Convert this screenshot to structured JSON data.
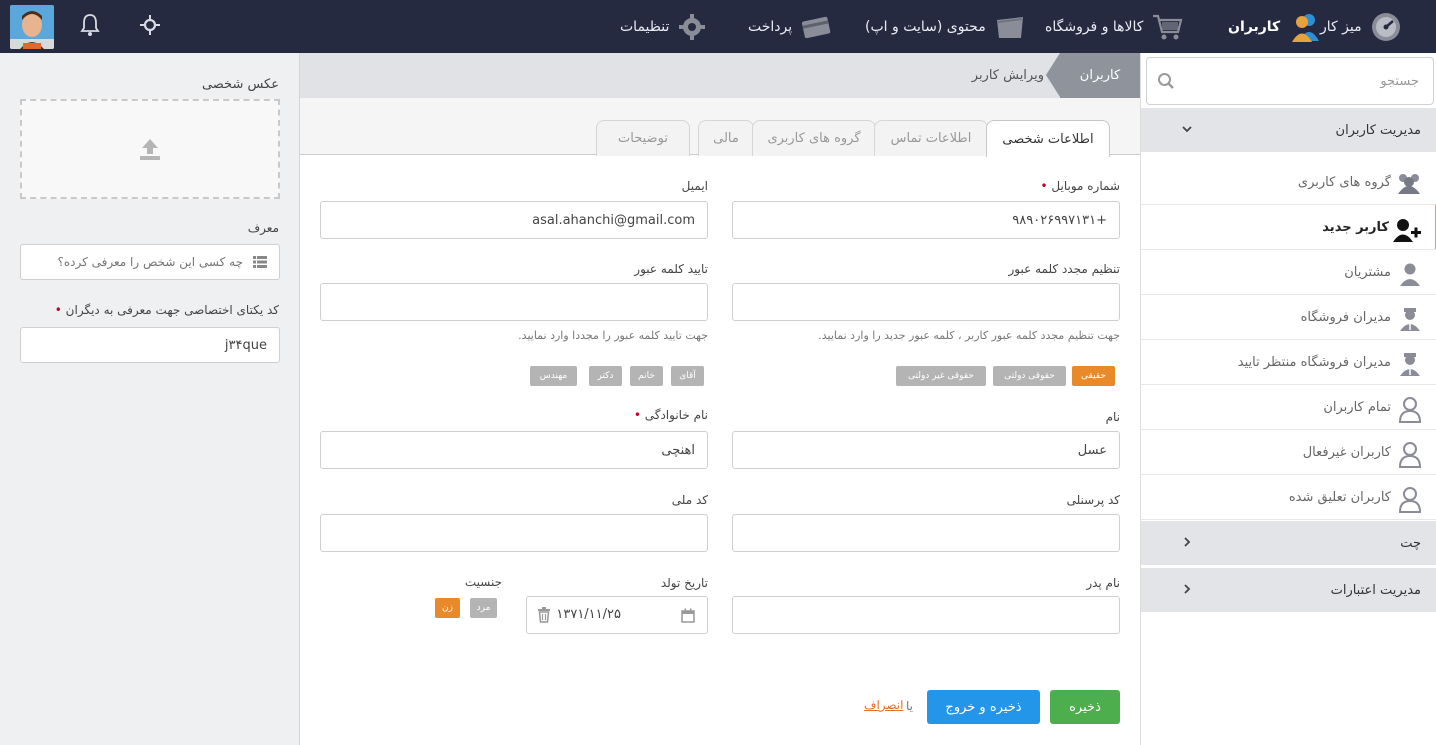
{
  "topbar": {
    "nav": [
      {
        "label": "میز کار",
        "icon": "dashboard-icon"
      },
      {
        "label": "کاربران",
        "icon": "users-icon"
      },
      {
        "label": "کالاها و فروشگاه",
        "icon": "cart-icon"
      },
      {
        "label": "محتوی (سایت و اپ)",
        "icon": "folder-icon"
      },
      {
        "label": "پرداخت",
        "icon": "credit-card-icon"
      },
      {
        "label": "تنظیمات",
        "icon": "gear-icon"
      }
    ],
    "colors": {
      "bar": "#262a40",
      "accent": "#e6a23c"
    }
  },
  "sidebar": {
    "search_placeholder": "جستجو",
    "section_users": "مدیریت کاربران",
    "items": [
      {
        "label": "گروه های کاربری"
      },
      {
        "label": "کاربر جدید"
      },
      {
        "label": "مشتریان"
      },
      {
        "label": "مدیران فروشگاه"
      },
      {
        "label": "مدیران فروشگاه منتظر تایید"
      },
      {
        "label": "تمام کاربران"
      },
      {
        "label": "کاربران غیرفعال"
      },
      {
        "label": "کاربران تعلیق شده"
      }
    ],
    "section_chat": "چت",
    "section_credit": "مدیریت اعتبارات"
  },
  "breadcrumb": {
    "root": "کاربران",
    "current": "ویرایش کاربر"
  },
  "tabs": [
    {
      "label": "اطلاعات شخصی"
    },
    {
      "label": "اطلاعات تماس"
    },
    {
      "label": "گروه های کاربری"
    },
    {
      "label": "مالی"
    },
    {
      "label": "توضیحات"
    }
  ],
  "form": {
    "mobile_label": "شماره موبایل",
    "mobile_value": "+۹۸۹۰۲۶۹۹۷۱۳۱",
    "email_label": "ایمیل",
    "email_value": "asal.ahanchi@gmail.com",
    "reset_pw_label": "تنظیم مجدد کلمه عبور",
    "reset_pw_help": "جهت تنظیم مجدد کلمه عبور کاربر ، کلمه عبور جدید را وارد نمایید.",
    "confirm_pw_label": "تایید کلمه عبور",
    "confirm_pw_help": "جهت تایید کلمه عبور را مجددا وارد نمایید.",
    "person_types": [
      "حقیقی",
      "حقوقی دولتی",
      "حقوقی غیر دولتی"
    ],
    "titles": [
      "آقای",
      "خانم",
      "دکتر",
      "مهندس"
    ],
    "first_name_label": "نام",
    "first_name_value": "عسل",
    "last_name_label": "نام خانوادگی",
    "last_name_value": "آهنچی",
    "personnel_code_label": "کد پرسنلی",
    "national_code_label": "کد ملی",
    "father_name_label": "نام پدر",
    "birth_date_label": "تاریخ تولد",
    "birth_date_value": "۱۳۷۱/۱۱/۲۵",
    "gender_label": "جنسیت",
    "gender_male": "مرد",
    "gender_female": "زن"
  },
  "actions": {
    "save": "ذخیره",
    "save_exit": "ذخیره و خروج",
    "or": "یا",
    "cancel": "انصراف"
  },
  "left": {
    "photo_label": "عکس شخصی",
    "referrer_label": "معرف",
    "referrer_placeholder": "چه کسی این شخص را معرفی کرده؟",
    "ref_code_label": "کد یکتای اختصاصی جهت معرفی به دیگران",
    "ref_code_value": "j۳۴que"
  }
}
